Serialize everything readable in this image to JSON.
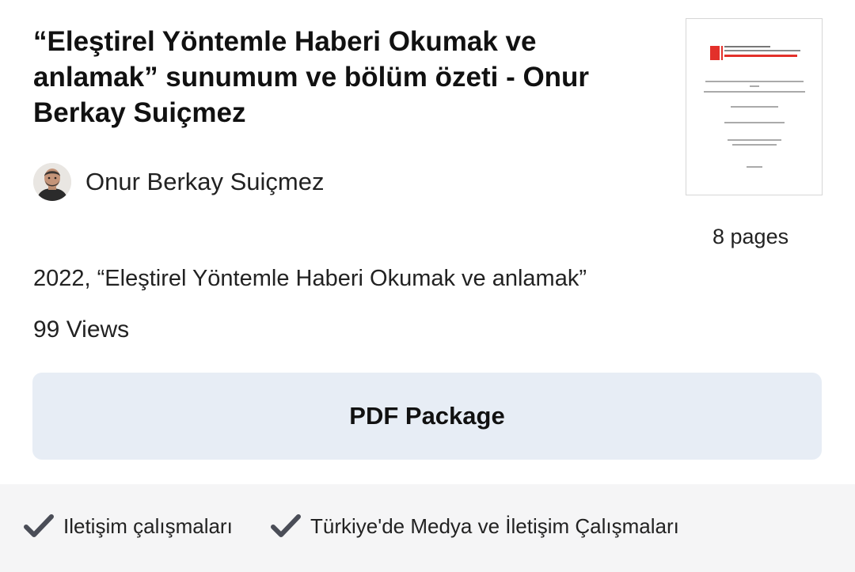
{
  "document": {
    "title": "“Eleştirel Yöntemle Haberi Okumak ve anlamak” sunumum ve bölüm özeti - Onur Berkay Suiçmez",
    "author": "Onur Berkay Suiçmez",
    "pages_label": "8 pages",
    "meta": "2022, “Eleştirel Yöntemle Haberi Okumak ve anlamak”",
    "views": "99 Views"
  },
  "actions": {
    "pdf_package_label": "PDF Package"
  },
  "tags": [
    {
      "label": "Iletişim çalışmaları"
    },
    {
      "label": "Türkiye'de Medya ve İletişim Çalışmaları"
    }
  ],
  "colors": {
    "button_bg": "#e7edf5",
    "tags_bar_bg": "#f5f5f6",
    "check_icon": "#4a4d57",
    "thumb_logo_red": "#e3302a"
  },
  "icons": {
    "check": "check-icon",
    "avatar": "user-avatar"
  }
}
